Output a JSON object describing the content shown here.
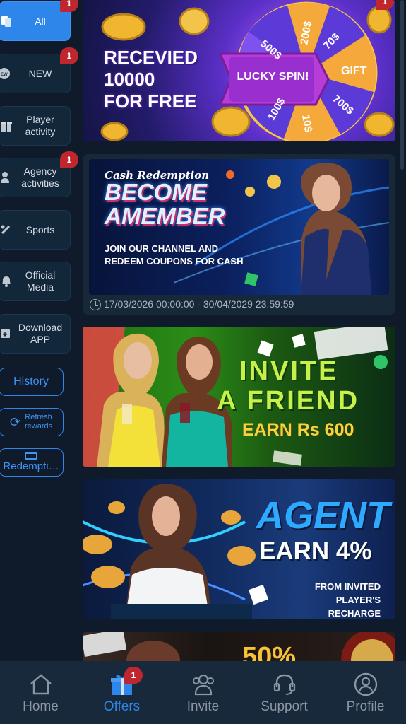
{
  "sidebar": {
    "items": [
      {
        "label": "All",
        "badge": "1"
      },
      {
        "label": "NEW",
        "badge": "1"
      },
      {
        "label": "Player\nactivity"
      },
      {
        "label": "Agency\nactivities",
        "badge": "1"
      },
      {
        "label": "Sports"
      },
      {
        "label": "Official\nMedia"
      },
      {
        "label": "Download\nAPP"
      }
    ],
    "history_label": "History",
    "refresh_label": "Refresh\nrewards",
    "redemption_label": "Redempti…"
  },
  "banners": {
    "spin": {
      "headline": "RECEVIED\n10000\nFOR FREE",
      "center": "LUCKY SPIN!",
      "slices": [
        "200$",
        "70$",
        "GIFT",
        "700$",
        "10$",
        "100$",
        "500$"
      ],
      "badge": "1"
    },
    "member": {
      "script": "Cash Redemption",
      "headline": "BECOME\nAMEMBER",
      "sub": "JOIN OUR CHANNEL AND\nREDEEM COUPONS FOR CASH",
      "dates": "17/03/2026 00:00:00 - 30/04/2029 23:59:59"
    },
    "invite": {
      "line1": "INVITE",
      "line2": "A FRIEND",
      "earn": "EARN Rs 600"
    },
    "agent": {
      "line1": "AGENT",
      "line2": "EARN 4%",
      "sub": "FROM INVITED\nPLAYER'S RECHARGE"
    },
    "partial": {
      "text": "50%"
    }
  },
  "nav": {
    "items": [
      {
        "label": "Home"
      },
      {
        "label": "Offers",
        "badge": "1"
      },
      {
        "label": "Invite"
      },
      {
        "label": "Support"
      },
      {
        "label": "Profile"
      }
    ]
  },
  "colors": {
    "accent": "#2f86ea",
    "background": "#0f1b2b",
    "badge": "#c0262d"
  }
}
